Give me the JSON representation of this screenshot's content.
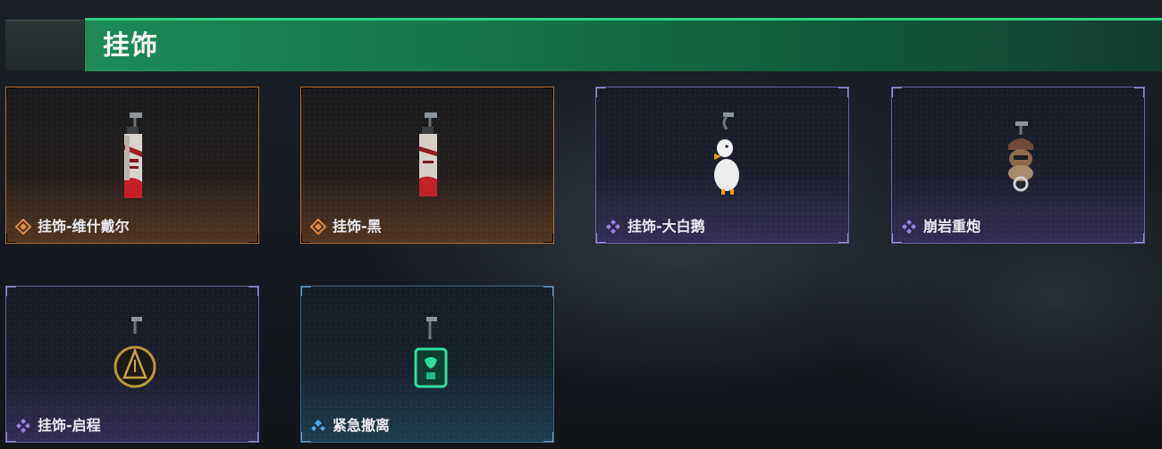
{
  "section": {
    "title": "挂饰"
  },
  "colors": {
    "header_accent": "#2bd182",
    "rarity_orange": "#e08a45",
    "rarity_purple": "#9b7fe0",
    "rarity_blue": "#5aa5e0"
  },
  "items": [
    {
      "name": "挂饰-维什戴尔",
      "rarity": "orange",
      "icon": "charm-red-white-tag-icon"
    },
    {
      "name": "挂饰-黑",
      "rarity": "orange",
      "icon": "charm-red-white-tag-icon"
    },
    {
      "name": "挂饰-大白鹅",
      "rarity": "purple",
      "icon": "charm-white-goose-icon"
    },
    {
      "name": "崩岩重炮",
      "rarity": "purple",
      "icon": "charm-artillery-figure-icon"
    },
    {
      "name": "挂饰-启程",
      "rarity": "purple",
      "icon": "charm-round-emblem-icon"
    },
    {
      "name": "紧急撤离",
      "rarity": "blue",
      "icon": "charm-green-square-icon"
    }
  ]
}
